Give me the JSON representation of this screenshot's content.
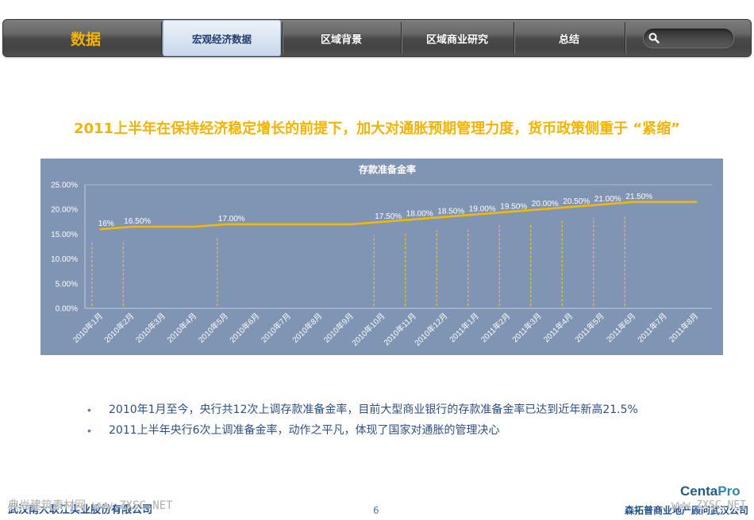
{
  "nav": {
    "brand": "数据",
    "tabs": [
      {
        "label": "宏观经济数据",
        "active": true
      },
      {
        "label": "区域背景",
        "active": false
      },
      {
        "label": "区域商业研究",
        "active": false
      },
      {
        "label": "总结",
        "active": false
      }
    ],
    "search_icon": "search-icon"
  },
  "headline": "2011上半年在保持经济稳定增长的前提下，加大对通胀预期管理力度，货币政策侧重于 “紧缩”",
  "chart_data": {
    "type": "line",
    "title": "存款准备金率",
    "categories": [
      "2010年1月",
      "2010年2月",
      "2010年3月",
      "2010年4月",
      "2010年5月",
      "2010年6月",
      "2010年7月",
      "2010年8月",
      "2010年9月",
      "2010年10月",
      "2010年11月",
      "2010年12月",
      "2011年1月",
      "2011年2月",
      "2011年3月",
      "2011年4月",
      "2011年5月",
      "2011年6月",
      "2011年7月",
      "2011年8月"
    ],
    "series": [
      {
        "values": [
          16,
          16.5,
          16.5,
          16.5,
          17,
          17,
          17,
          17,
          17,
          17.5,
          18,
          18.5,
          19,
          19.5,
          20,
          20.5,
          21,
          21.5,
          21.5,
          21.5
        ]
      }
    ],
    "data_labels": [
      "16%",
      "16.50%",
      "",
      "",
      "17.00%",
      "",
      "",
      "",
      "",
      "17.50%",
      "18.00%",
      "18.50%",
      "19.00%",
      "19.50%",
      "20.00%",
      "20.50%",
      "21.00%",
      "21.50%",
      "",
      ""
    ],
    "ylim": [
      0,
      25
    ],
    "y_ticks": [
      0,
      5,
      10,
      15,
      20,
      25
    ],
    "y_tick_labels": [
      "0.00%",
      "5.00%",
      "10.00%",
      "15.00%",
      "20.00%",
      "25.00%"
    ],
    "grid": false,
    "legend": "none",
    "colors": {
      "background": "#8094b3",
      "line": "#f5b800",
      "drop_line": "#f2c230",
      "text": "#ffffff",
      "axis": "#c3cedd"
    }
  },
  "bullets": [
    "2010年1月至今，央行共12次上调存款准备金率，目前大型商业银行的存款准备金率已达到近年新高21.5%",
    "2011上半年央行6次上调准备金率，动作之平凡，体现了国家对通胀的管理决心"
  ],
  "footer": {
    "company_left": "武汉南大联江实业股份有限公司",
    "page_number": "6",
    "brand_a": "Centa",
    "brand_b": "Pro",
    "company_right": "森拓普商业地产顾问武汉公司",
    "watermark_left": "典尚建筑素材网 www.ZXSC.NET",
    "watermark_right": "www.ZXSC.NET"
  },
  "colors": {
    "accent": "#f4b300",
    "nav_active_text": "#1f3c6c",
    "bullet_text": "#2f4f80",
    "bullet_dot": "#5b7fb3",
    "footer_blue": "#1f4e8c"
  }
}
